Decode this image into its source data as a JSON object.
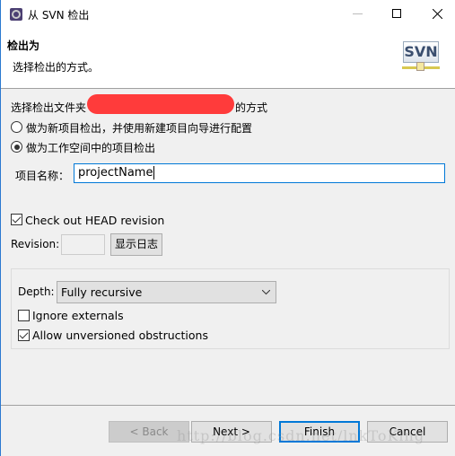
{
  "window": {
    "title": "从 SVN 检出",
    "app_icon": "eclipse-gear-icon",
    "controls": [
      "minimize-icon",
      "maximize-icon",
      "close-icon"
    ]
  },
  "header": {
    "title": "检出为",
    "subtitle": "选择检出的方式。",
    "logo_text": "SVN"
  },
  "body": {
    "folder_prefix": "选择检出文件夹",
    "folder_suffix": "的方式",
    "radio_new_project": {
      "label": "做为新项目检出，并使用新建项目向导进行配置",
      "checked": false
    },
    "radio_workspace": {
      "label": "做为工作空间中的项目检出",
      "checked": true
    },
    "project_name_label": "项目名称：",
    "project_name_value": "projectName",
    "check_head": {
      "label": "Check out HEAD revision",
      "checked": true
    },
    "revision_label": "Revision:",
    "revision_value": "",
    "show_log_label": "显示日志",
    "depth_label": "Depth:",
    "depth_value": "Fully recursive",
    "ignore_externals": {
      "label": "Ignore externals",
      "checked": false
    },
    "allow_unversioned": {
      "label": "Allow unversioned obstructions",
      "checked": true
    }
  },
  "footer": {
    "back": "< Back",
    "next": "Next >",
    "finish": "Finish",
    "cancel": "Cancel",
    "watermark": "http://blog.csdn.net/lnkToKing"
  },
  "colors": {
    "accent": "#0078d7",
    "redaction": "#ff3b3b"
  }
}
